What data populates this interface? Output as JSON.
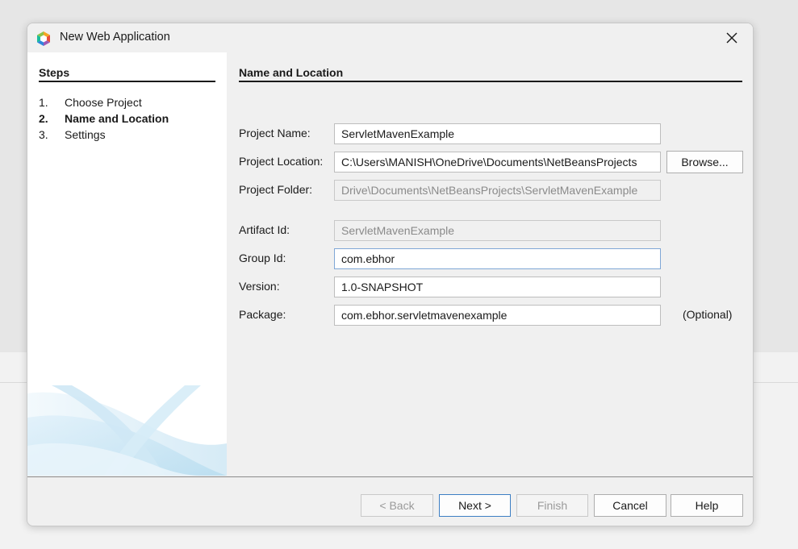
{
  "dialog": {
    "title": "New Web Application",
    "icon": "netbeans-logo-icon",
    "close_glyph": "✕"
  },
  "steps": {
    "heading": "Steps",
    "items": [
      {
        "num": "1.",
        "label": "Choose Project",
        "current": false
      },
      {
        "num": "2.",
        "label": "Name and Location",
        "current": true
      },
      {
        "num": "3.",
        "label": "Settings",
        "current": false
      }
    ]
  },
  "main": {
    "heading": "Name and Location",
    "project_name": {
      "label": "Project Name:",
      "value": "ServletMavenExample"
    },
    "project_location": {
      "label": "Project Location:",
      "value": "C:\\Users\\MANISH\\OneDrive\\Documents\\NetBeansProjects"
    },
    "browse_label": "Browse...",
    "project_folder": {
      "label": "Project Folder:",
      "value": "Drive\\Documents\\NetBeansProjects\\ServletMavenExample"
    },
    "artifact_id": {
      "label": "Artifact Id:",
      "value": "ServletMavenExample"
    },
    "group_id": {
      "label": "Group Id:",
      "value": "com.ebhor"
    },
    "version": {
      "label": "Version:",
      "value": "1.0-SNAPSHOT"
    },
    "package": {
      "label": "Package:",
      "value": "com.ebhor.servletmavenexample",
      "note": "(Optional)"
    }
  },
  "buttons": {
    "back": "< Back",
    "next": "Next >",
    "finish": "Finish",
    "cancel": "Cancel",
    "help": "Help"
  },
  "colors": {
    "accent": "#3d7fc4",
    "focus": "#7fa7d6"
  }
}
